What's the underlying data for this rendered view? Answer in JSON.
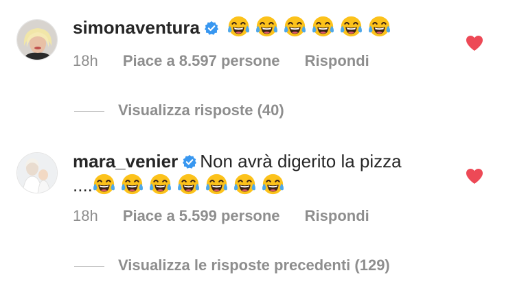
{
  "comments": [
    {
      "username": "simonaventura",
      "text": "",
      "emoji_count": 6,
      "time": "18h",
      "likes": "Piace a 8.597 persone",
      "reply": "Rispondi",
      "view_replies": "Visualizza risposte (40)",
      "liked": true
    },
    {
      "username": "mara_venier",
      "text": "Non avrà  digerito la pizza",
      "text_line2": "....",
      "emoji_count": 7,
      "time": "18h",
      "likes": "Piace a 5.599 persone",
      "reply": "Rispondi",
      "view_replies": "Visualizza le risposte precedenti (129)",
      "liked": true
    }
  ],
  "colors": {
    "primary_text": "#262626",
    "secondary_text": "#8e8e8e",
    "verified_badge": "#3897f0",
    "heart": "#ed4956",
    "emoji_face": "#fcc21b"
  },
  "icons": {
    "verified": "verified-badge-icon",
    "heart": "heart-icon",
    "emoji": "tears-of-joy-emoji"
  }
}
